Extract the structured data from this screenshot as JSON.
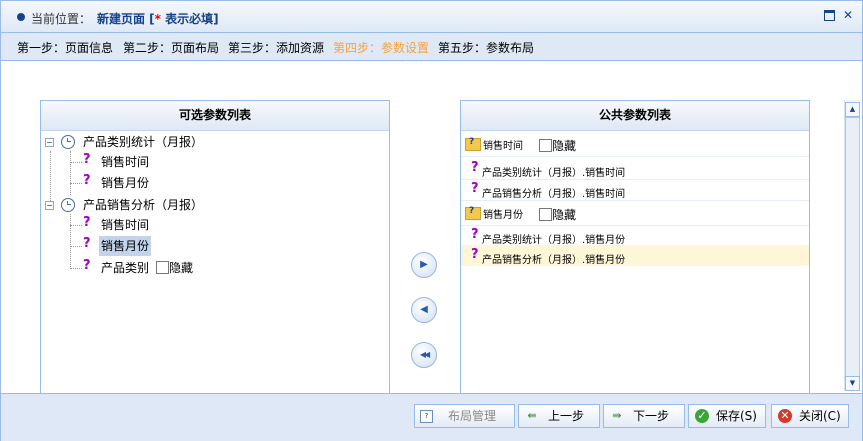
{
  "header": {
    "location_label": "当前位置：",
    "page_title": "新建页面 [",
    "required_marker": "*",
    "required_note": " 表示必填]"
  },
  "steps": [
    {
      "label": "第一步：页面信息",
      "active": false
    },
    {
      "label": "第二步：页面布局",
      "active": false
    },
    {
      "label": "第三步：添加资源",
      "active": false
    },
    {
      "label": "第四步：参数设置",
      "active": true
    },
    {
      "label": "第五步：参数布局",
      "active": false
    }
  ],
  "left_panel": {
    "title": "可选参数列表",
    "tree": [
      {
        "label": "产品类别统计（月报）",
        "children": [
          "销售时间",
          "销售月份"
        ]
      },
      {
        "label": "产品销售分析（月报）",
        "children": [
          "销售时间",
          "销售月份",
          "产品类别"
        ]
      }
    ],
    "selected_item": "销售月份",
    "hide_label": "隐藏"
  },
  "right_panel": {
    "title": "公共参数列表",
    "groups": [
      {
        "name": "销售时间",
        "hide_label": "隐藏",
        "items": [
          "产品类别统计（月报）.销售时间",
          "产品销售分析（月报）.销售时间"
        ]
      },
      {
        "name": "销售月份",
        "hide_label": "隐藏",
        "items": [
          "产品类别统计（月报）.销售月份",
          "产品销售分析（月报）.销售月份"
        ]
      }
    ]
  },
  "transfer_buttons": {
    "add": "▶",
    "remove": "◀",
    "remove_all": "◀◀"
  },
  "footer": {
    "layout_label": "布局管理",
    "prev_label": "上一步",
    "next_label": "下一步",
    "save_label": "保存(S)",
    "close_label": "关闭(C)"
  },
  "colors": {
    "accent": "#15428b",
    "active_step": "#f7a23a",
    "border": "#99bbe8",
    "highlight_row": "#fdf7d8"
  }
}
